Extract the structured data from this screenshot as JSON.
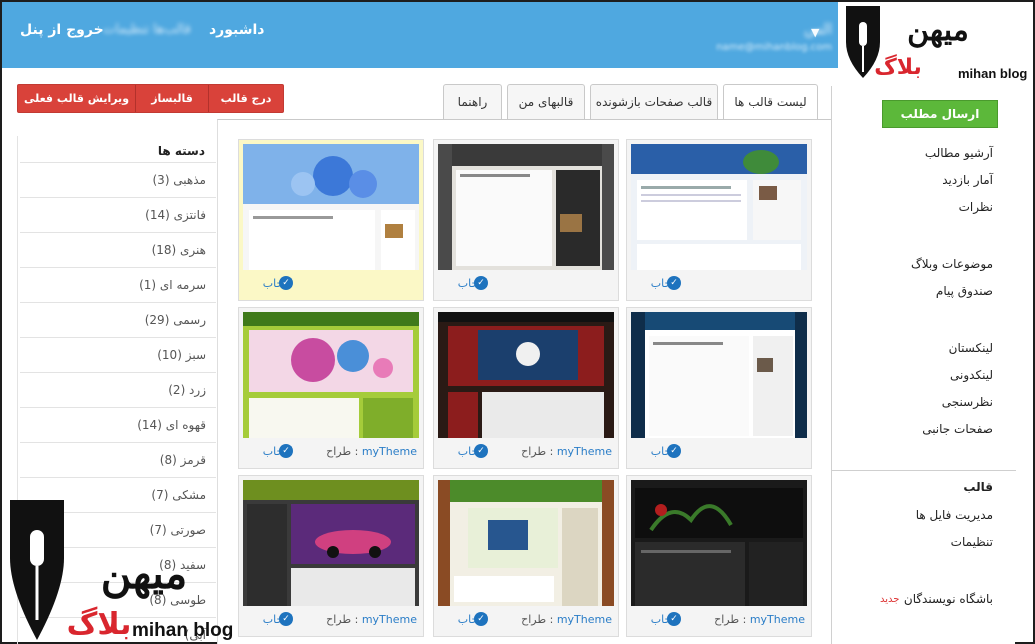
{
  "topbar": {
    "user_name": "الس",
    "user_email": "name@mihanblog.com",
    "nav_dashboard": "داشبورد",
    "nav_blurred": "قالب‌ها تنظیمات",
    "nav_exit": "خروج از پنل"
  },
  "logo": {
    "text_top": "میهن",
    "text_mid": "بلاگ",
    "text_en": "mihan blog"
  },
  "sidebar": {
    "send_button": "ارسال مطلب",
    "links_a": [
      "آرشیو مطالب",
      "آمار بازدید",
      "نظرات"
    ],
    "links_b": [
      "موضوعات وبلاگ",
      "صندوق پیام"
    ],
    "links_c": [
      "لینکستان",
      "لینکدونی",
      "نظرسنجی",
      "صفحات جانبی"
    ],
    "section_template": "قالب",
    "links_d": [
      "مدیریت فایل ها",
      "تنظیمات"
    ],
    "writers_club": "باشگاه نویسندگان",
    "new_badge": "جدید"
  },
  "tabs": [
    "لیست قالب ها",
    "قالب صفحات بازشونده",
    "قالبهای من",
    "راهنما"
  ],
  "actions": [
    "درج قالب",
    "قالبساز",
    "ویرایش قالب فعلی"
  ],
  "cards": {
    "select_label": "انتخاب",
    "designer_label": "طراح :",
    "designer_name": "myTheme"
  },
  "categories": {
    "title": "دسته ها",
    "items": [
      "(مذهبی (3",
      "(فانتزی (14",
      "(هنری (18",
      "(سرمه ای (1",
      "(رسمی (29",
      "(سبز (10",
      "(زرد (2",
      "(قهوه ای (14",
      "(قرمز (8",
      "(مشکی (7",
      "(صورتی (7",
      "(سفید (8",
      "(طوسی (8",
      "(آبی"
    ]
  },
  "colors": {
    "topbar": "#4fa8e0",
    "send_button": "#5cb83a",
    "actions": "#d9423a",
    "link": "#2a7dc7"
  }
}
